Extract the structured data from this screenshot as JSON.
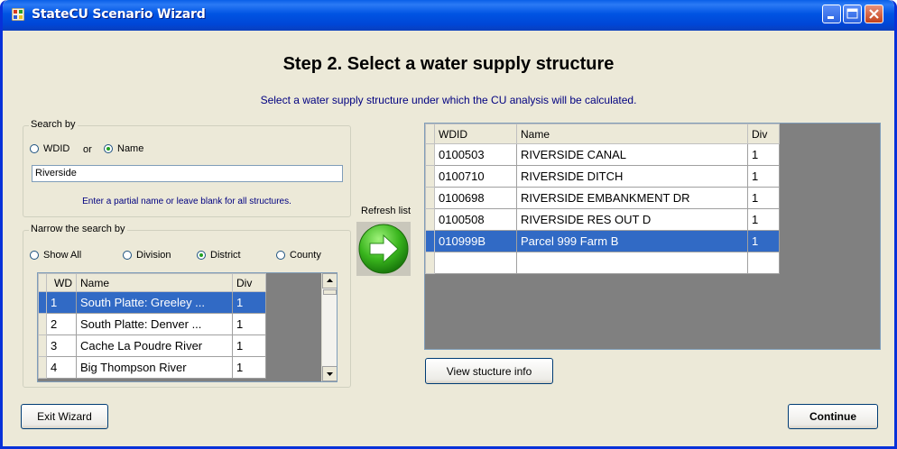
{
  "window": {
    "title": "StateCU Scenario Wizard"
  },
  "header": {
    "step_title": "Step 2.  Select a water supply structure",
    "subtitle": "Select a water supply structure under which the CU analysis will be calculated."
  },
  "search_by": {
    "legend": "Search by",
    "wdid_label": "WDID",
    "or_label": "or",
    "name_label": "Name",
    "selected": "Name",
    "query": "Riverside",
    "hint": "Enter a partial name or leave blank for all structures."
  },
  "narrow": {
    "legend": "Narrow the search by",
    "options": [
      "Show All",
      "Division",
      "District",
      "County"
    ],
    "selected": "District",
    "columns": [
      "WD",
      "Name",
      "Div"
    ],
    "rows": [
      {
        "wd": "1",
        "name": "South Platte: Greeley ...",
        "div": "1",
        "selected": true
      },
      {
        "wd": "2",
        "name": "South Platte: Denver ...",
        "div": "1",
        "selected": false
      },
      {
        "wd": "3",
        "name": "Cache La Poudre River",
        "div": "1",
        "selected": false
      },
      {
        "wd": "4",
        "name": "Big Thompson River",
        "div": "1",
        "selected": false
      }
    ]
  },
  "refresh": {
    "label": "Refresh list",
    "icon": "green-arrow-right-icon"
  },
  "results": {
    "columns": [
      "WDID",
      "Name",
      "Div"
    ],
    "rows": [
      {
        "wdid": "0100503",
        "name": "RIVERSIDE CANAL",
        "div": "1",
        "selected": false
      },
      {
        "wdid": "0100710",
        "name": "RIVERSIDE DITCH",
        "div": "1",
        "selected": false
      },
      {
        "wdid": "0100698",
        "name": "RIVERSIDE EMBANKMENT DR",
        "div": "1",
        "selected": false
      },
      {
        "wdid": "0100508",
        "name": "RIVERSIDE RES OUT D",
        "div": "1",
        "selected": false
      },
      {
        "wdid": "010999B",
        "name": "Parcel 999 Farm B",
        "div": "1",
        "selected": true
      }
    ]
  },
  "buttons": {
    "view_info": "View stucture info",
    "exit": "Exit Wizard",
    "continue": "Continue"
  },
  "colors": {
    "title_bar": "#0054e3",
    "selection": "#316ac5",
    "dialog_bg": "#ece9d8",
    "hint_text": "#000080"
  }
}
